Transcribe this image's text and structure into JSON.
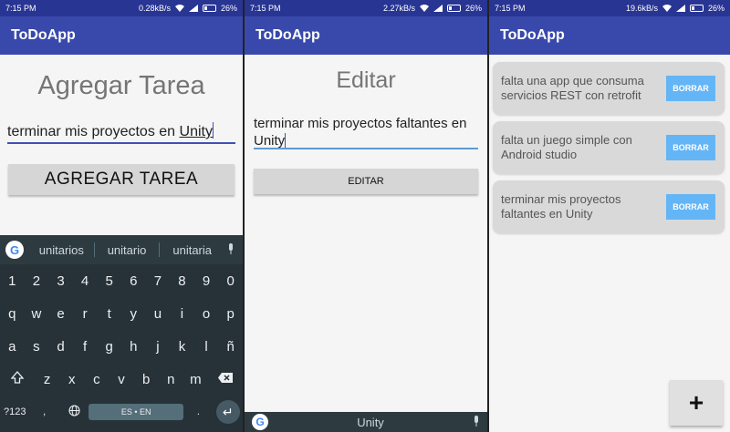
{
  "screens": [
    {
      "status": {
        "time": "7:15 PM",
        "speed": "0.28kB/s",
        "battery": "26%"
      },
      "app_title": "ToDoApp",
      "heading": "Agregar Tarea",
      "input_value_pre": "terminar mis proyectos en ",
      "input_value_word": "Unity",
      "button_label": "AGREGAR TAREA",
      "keyboard": {
        "suggestions": [
          "unitarios",
          "unitario",
          "unitaria"
        ],
        "row1": [
          "1",
          "2",
          "3",
          "4",
          "5",
          "6",
          "7",
          "8",
          "9",
          "0"
        ],
        "row2": [
          "q",
          "w",
          "e",
          "r",
          "t",
          "y",
          "u",
          "i",
          "o",
          "p"
        ],
        "row3": [
          "a",
          "s",
          "d",
          "f",
          "g",
          "h",
          "j",
          "k",
          "l",
          "ñ"
        ],
        "row4": [
          "z",
          "x",
          "c",
          "v",
          "b",
          "n",
          "m"
        ],
        "symbols_key": "?123",
        "emoji_key": ",",
        "space_label": "ES • EN"
      }
    },
    {
      "status": {
        "time": "7:15 PM",
        "speed": "2.27kB/s",
        "battery": "26%"
      },
      "app_title": "ToDoApp",
      "heading": "Editar",
      "input_value": "terminar mis proyectos faltantes en Unity",
      "button_label": "EDITAR",
      "keyboard_word": "Unity"
    },
    {
      "status": {
        "time": "7:15 PM",
        "speed": "19.6kB/s",
        "battery": "26%"
      },
      "app_title": "ToDoApp",
      "tasks": [
        {
          "text": "falta una app que consuma servicios REST con retrofit",
          "delete_label": "BORRAR"
        },
        {
          "text": "falta un juego simple con Android studio",
          "delete_label": "BORRAR"
        },
        {
          "text": "terminar mis proyectos faltantes en Unity",
          "delete_label": "BORRAR"
        }
      ],
      "fab_label": "+"
    }
  ]
}
